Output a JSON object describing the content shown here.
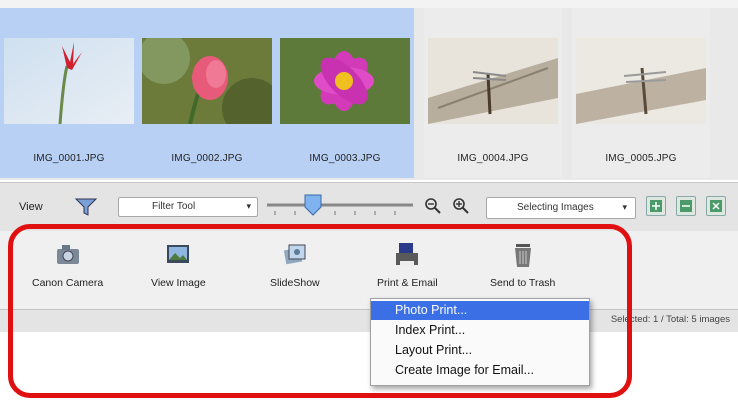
{
  "thumbnails": [
    {
      "filename": "IMG_0001.JPG",
      "selected": true
    },
    {
      "filename": "IMG_0002.JPG",
      "selected": true
    },
    {
      "filename": "IMG_0003.JPG",
      "selected": true
    },
    {
      "filename": "IMG_0004.JPG",
      "selected": false
    },
    {
      "filename": "IMG_0005.JPG",
      "selected": false
    }
  ],
  "toolbar": {
    "view_label": "View",
    "filter_select": "Filter Tool",
    "selection_select": "Selecting Images"
  },
  "actions": [
    {
      "label": "Canon Camera",
      "icon": "camera-icon"
    },
    {
      "label": "View Image",
      "icon": "view-image-icon"
    },
    {
      "label": "SlideShow",
      "icon": "slideshow-icon"
    },
    {
      "label": "Print & Email",
      "icon": "printer-icon"
    },
    {
      "label": "Send to Trash",
      "icon": "trash-icon"
    }
  ],
  "status": {
    "text": "Selected: 1 / Total: 5 images"
  },
  "menu": {
    "items": [
      {
        "label": "Photo Print...",
        "highlighted": true
      },
      {
        "label": "Index Print...",
        "highlighted": false
      },
      {
        "label": "Layout Print...",
        "highlighted": false
      },
      {
        "label": "Create Image for Email...",
        "highlighted": false
      }
    ]
  },
  "colors": {
    "selection": "#b8d0f4",
    "menu_highlight": "#3a6fe6",
    "annotation_red": "#e01010"
  }
}
